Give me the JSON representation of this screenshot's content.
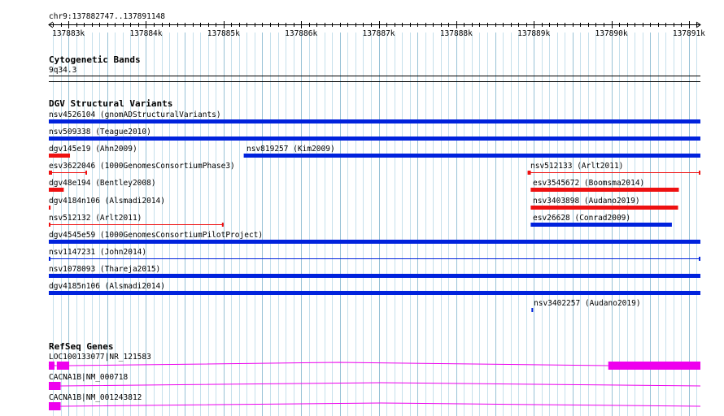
{
  "region": {
    "label": "chr9:137882747..137891148",
    "start": 137882747,
    "end": 137891148
  },
  "ruler": {
    "ticks": [
      "137883k",
      "137884k",
      "137885k",
      "137886k",
      "137887k",
      "137888k",
      "137889k",
      "137890k",
      "137891k"
    ]
  },
  "tracks": {
    "cytobands": {
      "title": "Cytogenetic Bands",
      "band": "9q34.3"
    },
    "dgv": {
      "title": "DGV Structural Variants",
      "colors": {
        "gain": "#0022dd",
        "loss": "#ee1111"
      },
      "variants": [
        {
          "id": "nsv4526104",
          "label": "nsv4526104 (gnomADStructuralVariants)",
          "start": 137882747,
          "end": 137891148,
          "type": "gain",
          "style": "bar",
          "row": 0
        },
        {
          "id": "nsv509338",
          "label": "nsv509338 (Teague2010)",
          "start": 137882747,
          "end": 137891148,
          "type": "gain",
          "style": "bar",
          "row": 1
        },
        {
          "id": "dgv145e19",
          "label": "dgv145e19 (Ahn2009)",
          "start": 137882747,
          "end": 137883020,
          "type": "loss",
          "style": "bar",
          "row": 2
        },
        {
          "id": "nsv819257",
          "label": "nsv819257 (Kim2009)",
          "start": 137885260,
          "end": 137891148,
          "type": "gain",
          "style": "bar",
          "row": 2
        },
        {
          "id": "esv3622046",
          "label": "esv3622046 (1000GenomesConsortiumPhase3)",
          "start": 137882747,
          "end": 137883240,
          "type": "loss",
          "style": "interval",
          "row": 3
        },
        {
          "id": "nsv512133",
          "label": "nsv512133 (Arlt2011)",
          "start": 137888920,
          "end": 137891148,
          "type": "loss",
          "style": "interval",
          "row": 3
        },
        {
          "id": "dgv48e194",
          "label": "dgv48e194 (Bentley2008)",
          "start": 137882747,
          "end": 137882940,
          "type": "loss",
          "style": "bar",
          "row": 4
        },
        {
          "id": "esv3545672",
          "label": "esv3545672 (Boomsma2014)",
          "start": 137888960,
          "end": 137890870,
          "type": "loss",
          "style": "bar",
          "row": 4
        },
        {
          "id": "dgv4184n106",
          "label": "dgv4184n106 (Alsmadi2014)",
          "start": 137882747,
          "end": 137882770,
          "type": "loss",
          "style": "bar",
          "row": 5
        },
        {
          "id": "nsv3403898",
          "label": "nsv3403898 (Audano2019)",
          "start": 137888960,
          "end": 137890860,
          "type": "loss",
          "style": "bar",
          "row": 5
        },
        {
          "id": "nsv512132",
          "label": "nsv512132 (Arlt2011)",
          "start": 137882747,
          "end": 137885000,
          "type": "loss",
          "style": "line",
          "row": 6
        },
        {
          "id": "esv26628",
          "label": "esv26628 (Conrad2009)",
          "start": 137888960,
          "end": 137890780,
          "type": "gain",
          "style": "bar",
          "row": 6
        },
        {
          "id": "dgv4545e59",
          "label": "dgv4545e59 (1000GenomesConsortiumPilotProject)",
          "start": 137882747,
          "end": 137891148,
          "type": "gain",
          "style": "bar",
          "row": 7
        },
        {
          "id": "nsv1147231",
          "label": "nsv1147231 (John2014)",
          "start": 137882747,
          "end": 137891148,
          "type": "gain",
          "style": "line",
          "row": 8
        },
        {
          "id": "nsv1078093",
          "label": "nsv1078093 (Thareja2015)",
          "start": 137882747,
          "end": 137891148,
          "type": "gain",
          "style": "bar",
          "row": 9
        },
        {
          "id": "dgv4185n106",
          "label": "dgv4185n106 (Alsmadi2014)",
          "start": 137882747,
          "end": 137891148,
          "type": "gain",
          "style": "bar",
          "row": 10
        },
        {
          "id": "nsv3402257",
          "label": "nsv3402257 (Audano2019)",
          "start": 137888970,
          "end": 137888990,
          "type": "gain",
          "style": "bar",
          "row": 11
        }
      ]
    },
    "refseq": {
      "title": "RefSeq Genes",
      "color": "#ee00ee",
      "genes": [
        {
          "id": "LOC100133077",
          "label": "LOC100133077|NR_121583",
          "row": 0,
          "exons": [
            [
              137882747,
              137882820
            ],
            [
              137882850,
              137883010
            ],
            [
              137889960,
              137891148
            ]
          ]
        },
        {
          "id": "CACNA1B_718",
          "label": "CACNA1B|NM_000718",
          "row": 1,
          "exons": [
            [
              137882747,
              137882900
            ]
          ]
        },
        {
          "id": "CACNA1B_3812",
          "label": "CACNA1B|NM_001243812",
          "row": 2,
          "exons": [
            [
              137882747,
              137882900
            ]
          ]
        }
      ]
    }
  }
}
